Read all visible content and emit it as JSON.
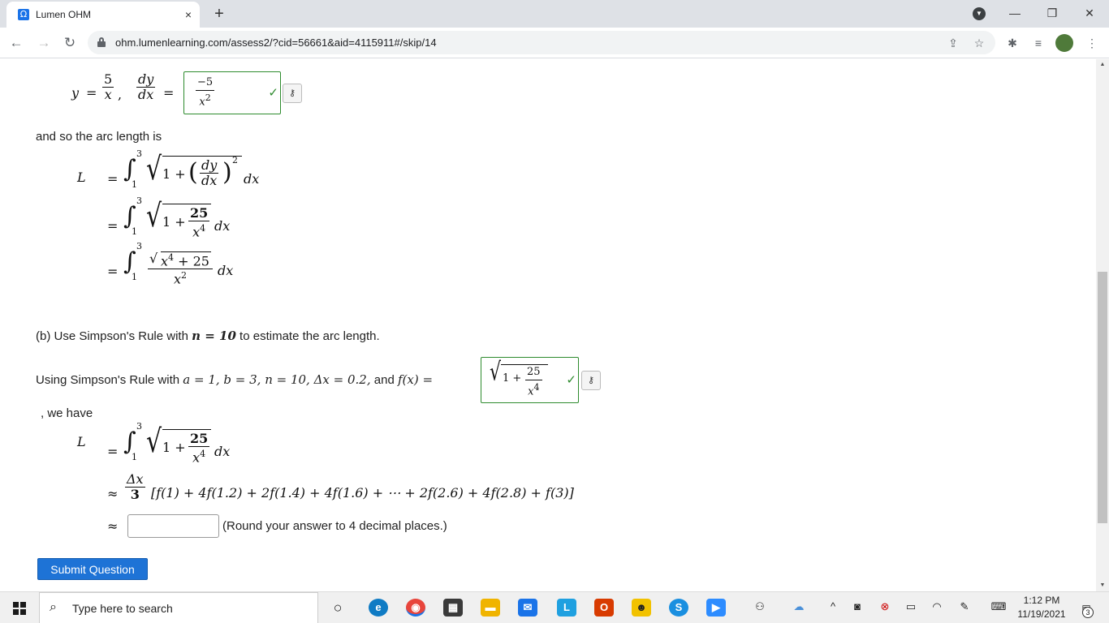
{
  "browser": {
    "tab_title": "Lumen OHM",
    "tab_favicon": "Ω",
    "new_tab": "+",
    "tab_close": "×",
    "url": "ohm.lumenlearning.com/assess2/?cid=56661&aid=4115911#/skip/14",
    "minimize": "—",
    "restore": "❐",
    "close": "✕"
  },
  "problem": {
    "eq1_y": "y",
    "eq1_eq": "=",
    "eq1_num": "5",
    "eq1_den": "x",
    "eq1_comma": ",",
    "eq1_dy": "dy",
    "eq1_dx": "dx",
    "answer1_num": "−5",
    "answer1_den": "x",
    "answer1_exp": "2",
    "arc_text": "and so the arc length is",
    "L": "L",
    "eq": "=",
    "lim_upper": "3",
    "lim_lower": "1",
    "one_plus": "1 +",
    "dy": "dy",
    "dx": "dx",
    "sq": "2",
    "num25": "25",
    "x": "x",
    "exp4": "4",
    "exp2": "2",
    "x4_plus_25": "+ 25",
    "part_b_pre": "(b) Use Simpson's Rule with ",
    "n_eq_10": "n = 10",
    "part_b_post": " to estimate the arc length.",
    "using_pre": "Using Simpson's Rule with ",
    "params": "a = 1,  b = 3,  n = 10,  Δx = 0.2,",
    "and_text": " and ",
    "fx": "f(x) =",
    "we_have": ", we have",
    "approx": "≈",
    "delta_x": "Δx",
    "three": "3",
    "simpson_sum": "[f(1) + 4f(1.2) + 2f(1.4) + 4f(1.6) + ⋯ + 2f(2.6) + 4f(2.8) + f(3)]",
    "round_note": "(Round your answer to 4 decimal places.)",
    "answer_value": "",
    "submit": "Submit Question",
    "check": "✓",
    "key": "o̲"
  },
  "taskbar": {
    "search_placeholder": "Type here to search",
    "time": "1:12 PM",
    "date": "11/19/2021",
    "notifications": "3"
  },
  "colors": {
    "correct": "#2e8b2e",
    "submit": "#1e73d6"
  }
}
